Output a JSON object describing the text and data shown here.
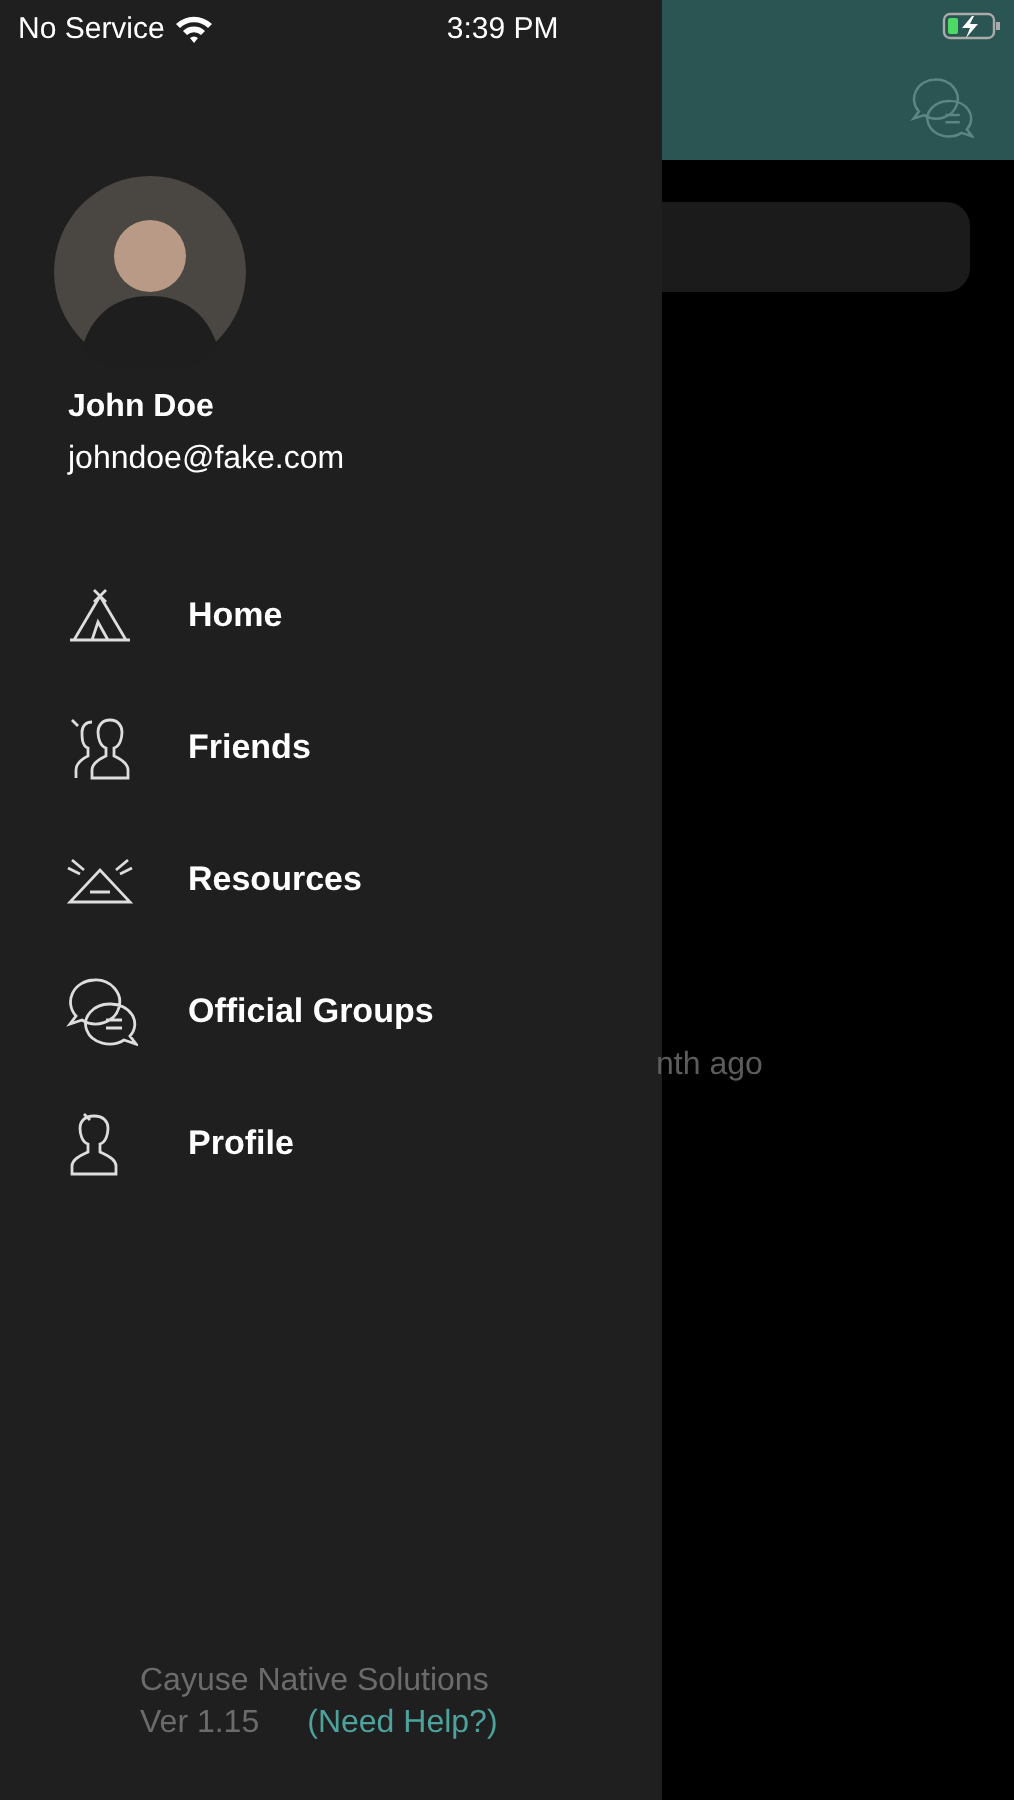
{
  "status_bar": {
    "carrier": "No Service",
    "time": "3:39 PM"
  },
  "drawer": {
    "user": {
      "name": "John Doe",
      "email": "johndoe@fake.com"
    },
    "menu": [
      {
        "label": "Home",
        "kind": "tipi"
      },
      {
        "label": "Friends",
        "kind": "people"
      },
      {
        "label": "Resources",
        "kind": "mountain"
      },
      {
        "label": "Official Groups",
        "kind": "chat"
      },
      {
        "label": "Profile",
        "kind": "person"
      }
    ],
    "footer": {
      "company": "Cayuse Native Solutions",
      "version": "Ver 1.15",
      "help_link": "(Need Help?)"
    }
  },
  "background": {
    "list_text": "nth ago"
  }
}
